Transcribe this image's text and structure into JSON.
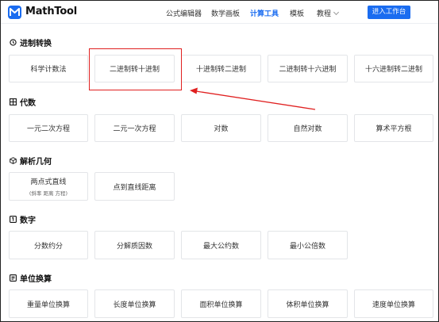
{
  "header": {
    "brand": "MathTool",
    "nav": [
      {
        "label": "公式编辑器",
        "active": false
      },
      {
        "label": "数学画板",
        "active": false
      },
      {
        "label": "计算工具",
        "active": true
      },
      {
        "label": "模板",
        "active": false
      },
      {
        "label": "教程",
        "active": false
      }
    ],
    "cta_label": "进入工作台"
  },
  "sections": [
    {
      "title": "进制转换",
      "icon": "history-icon",
      "items": [
        "科学计数法",
        "二进制转十进制",
        "十进制转二进制",
        "二进制转十六进制",
        "十六进制转二进制"
      ]
    },
    {
      "title": "代数",
      "icon": "grid-icon",
      "items": [
        "一元二次方程",
        "二元一次方程",
        "对数",
        "自然对数",
        "算术平方根"
      ]
    },
    {
      "title": "解析几何",
      "icon": "cube-icon",
      "items": [
        {
          "label": "两点式直线",
          "sub": "(斜率 距离 方程)"
        },
        "点到直线距离"
      ]
    },
    {
      "title": "数字",
      "icon": "number-box-icon",
      "items": [
        "分数约分",
        "分解质因数",
        "最大公约数",
        "最小公倍数"
      ]
    },
    {
      "title": "单位换算",
      "icon": "unit-icon",
      "items": [
        "重量单位换算",
        "长度单位换算",
        "面积单位换算",
        "体积单位换算",
        "速度单位换算"
      ]
    }
  ],
  "colors": {
    "accent": "#1a6cf0",
    "highlight": "#e02020"
  }
}
